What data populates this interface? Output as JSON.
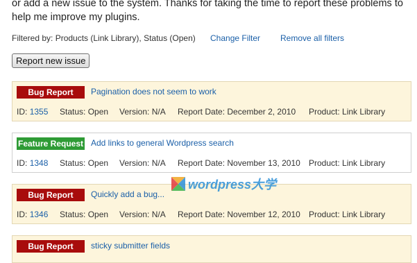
{
  "intro_text": "or add a new issue to the system. Thanks for taking the time to report these problems to help me improve my plugins.",
  "filters": {
    "text": "Filtered by: Products (Link Library), Status (Open)",
    "change_filter": "Change Filter",
    "remove_filters": "Remove all filters"
  },
  "report_button": "Report new issue",
  "labels": {
    "id": "ID:",
    "status": "Status:",
    "version": "Version:",
    "report_date": "Report Date:",
    "product": "Product:"
  },
  "issues": [
    {
      "type": "Bug Report",
      "title": "Pagination does not seem to work",
      "id": "1355",
      "status": "Open",
      "version": "N/A",
      "report_date": "December 2, 2010",
      "product": "Link Library"
    },
    {
      "type": "Feature Request",
      "title": "Add links to general Wordpress search",
      "id": "1348",
      "status": "Open",
      "version": "N/A",
      "report_date": "November 13, 2010",
      "product": "Link Library"
    },
    {
      "type": "Bug Report",
      "title": "Quickly add a bug...",
      "id": "1346",
      "status": "Open",
      "version": "N/A",
      "report_date": "November 12, 2010",
      "product": "Link Library"
    },
    {
      "type": "Bug Report",
      "title": "sticky submitter fields",
      "id": "",
      "status": "",
      "version": "",
      "report_date": "",
      "product": ""
    }
  ],
  "watermark": "wordpress大学",
  "colors": {
    "bug": "#a80c0c",
    "feature": "#2e9b35",
    "link": "#1a5fa8",
    "bug_card_bg": "#fdf5dc"
  }
}
